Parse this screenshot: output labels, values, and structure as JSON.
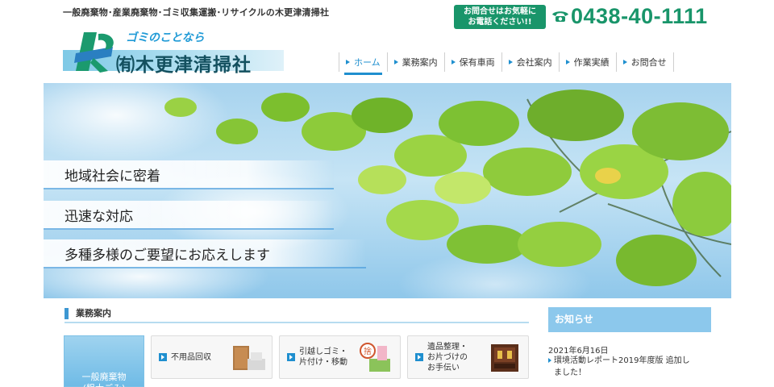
{
  "header": {
    "tagline": "一般廃棄物･産業廃棄物･ゴミ収集運搬･リサイクルの木更津清掃社",
    "contact_line1": "お問合せはお気軽に",
    "contact_line2": "お電話ください!!",
    "phone": "0438-40-1111"
  },
  "logo": {
    "tagline": "ゴミのことなら",
    "company": "㈲木更津清掃社"
  },
  "nav": {
    "items": [
      {
        "label": "ホーム",
        "active": true
      },
      {
        "label": "業務案内"
      },
      {
        "label": "保有車両"
      },
      {
        "label": "会社案内"
      },
      {
        "label": "作業実績"
      },
      {
        "label": "お問合せ"
      }
    ]
  },
  "hero": {
    "captions": [
      "地域社会に密着",
      "迅速な対応",
      "多種多様のご要望にお応えします"
    ]
  },
  "services": {
    "title": "業務案内",
    "side_card": "一般廃棄物\n(粗大ごみ)",
    "items": [
      {
        "label": "不用品回収",
        "icon": "furniture-icon"
      },
      {
        "label": "引越しゴミ・\n片付け・移動",
        "icon": "moving-icon"
      },
      {
        "label": "遺品整理・\nお片づけの\nお手伝い",
        "icon": "altar-icon"
      }
    ]
  },
  "news": {
    "title": "お知らせ",
    "date": "2021年6月16日",
    "text": "環境活動レポート2019年度版 追加しました！"
  },
  "colors": {
    "brand_green": "#19956a",
    "accent_blue": "#1f8fcf",
    "sky_blue": "#8cc8ec"
  }
}
